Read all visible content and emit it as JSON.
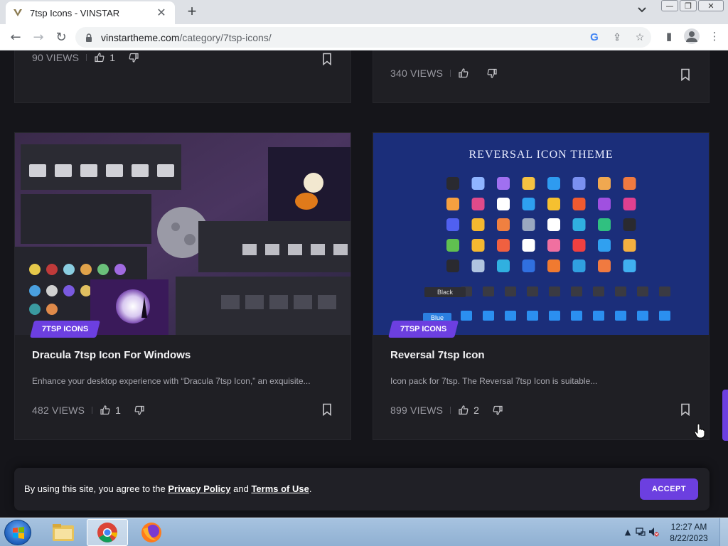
{
  "browser": {
    "tab_title": "7tsp Icons - VINSTAR",
    "tab_close": "✕",
    "new_tab": "+",
    "tab_search": "⌄",
    "url_domain": "vinstartheme.com",
    "url_path": "/category/7tsp-icons/",
    "window_controls": {
      "minimize": "—",
      "restore": "❐",
      "close": "✕"
    },
    "nav": {
      "back": "←",
      "forward": "→",
      "reload": "↻"
    },
    "omni_icons": {
      "google": "G",
      "share": "⇪",
      "star": "☆"
    },
    "right_icons": {
      "side_panel": "▮",
      "profile": "●",
      "menu": "⋮"
    }
  },
  "cards": [
    {
      "views": "90 VIEWS",
      "likes": "1"
    },
    {
      "views": "340 VIEWS",
      "likes": ""
    },
    {
      "badge": "7TSP ICONS",
      "title": "Dracula 7tsp Icon For Windows",
      "excerpt": "Enhance your desktop experience with “Dracula 7tsp Icon,” an exquisite...",
      "views": "482 VIEWS",
      "likes": "1"
    },
    {
      "badge": "7TSP ICONS",
      "title": "Reversal 7tsp Icon",
      "excerpt": "Icon pack for 7tsp. The Reversal 7tsp Icon is suitable...",
      "views": "899 VIEWS",
      "likes": "2",
      "image_heading": "REVERSAL ICON THEME",
      "image_label_black": "Black",
      "image_label_blue": "Blue"
    }
  ],
  "cookie": {
    "prefix": "By using this site, you agree to the ",
    "privacy": "Privacy Policy",
    "middle": " and ",
    "terms": "Terms of Use",
    "suffix": ".",
    "accept": "ACCEPT"
  },
  "taskbar": {
    "time": "12:27 AM",
    "date": "8/22/2023",
    "tray_arrow": "▲"
  },
  "colors": {
    "accent": "#6c3fe0",
    "page_bg": "#15151a",
    "card_bg": "#1f1f24"
  }
}
